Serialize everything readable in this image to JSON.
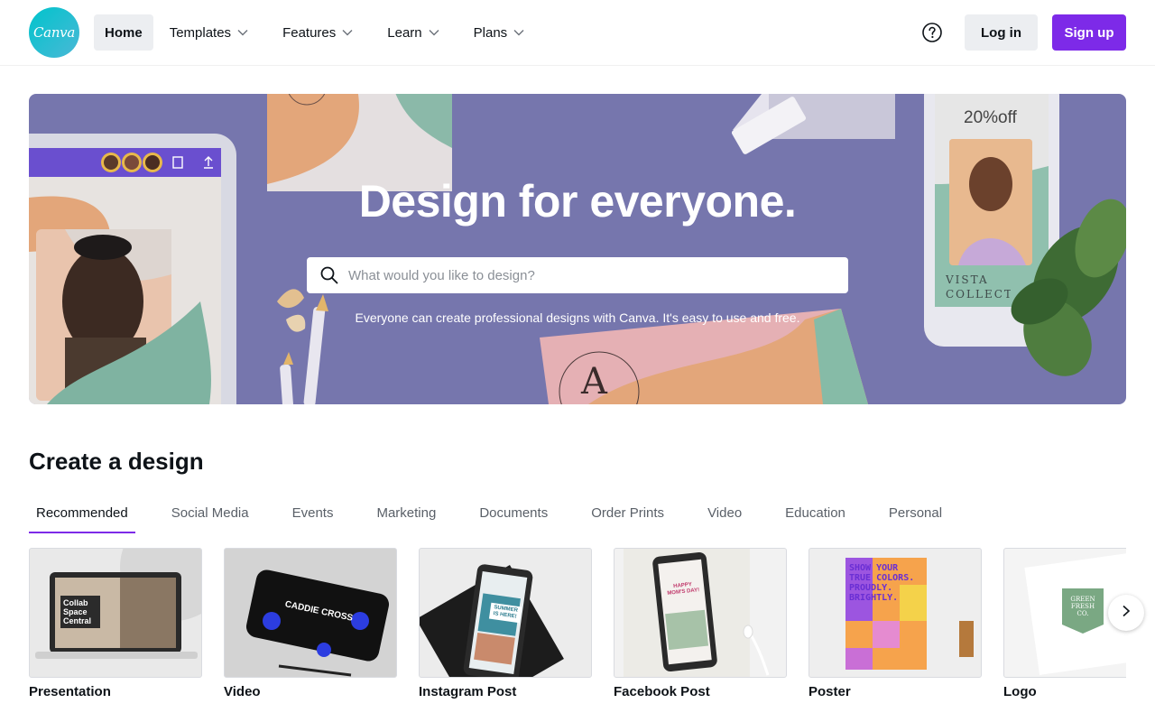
{
  "brand": {
    "logo_text": "Canva",
    "accent": "#7d2ae8",
    "logo_color": "#00c4cc"
  },
  "nav": {
    "items": [
      {
        "label": "Home",
        "active": true,
        "dropdown": false
      },
      {
        "label": "Templates",
        "active": false,
        "dropdown": true
      },
      {
        "label": "Features",
        "active": false,
        "dropdown": true
      },
      {
        "label": "Learn",
        "active": false,
        "dropdown": true
      },
      {
        "label": "Plans",
        "active": false,
        "dropdown": true
      }
    ],
    "help_icon": "question-circle-icon",
    "login_label": "Log in",
    "signup_label": "Sign up"
  },
  "hero": {
    "title": "Design for everyone.",
    "search_placeholder": "What would you like to design?",
    "subtitle": "Everyone can create professional designs with Canva. It's easy to use and free.",
    "promo_text": "20%off",
    "promo_brand": "VISTA COLLECTI",
    "card_letter": "A",
    "background_color": "#7676ad"
  },
  "create": {
    "title": "Create a design",
    "tabs": [
      {
        "label": "Recommended",
        "active": true
      },
      {
        "label": "Social Media",
        "active": false
      },
      {
        "label": "Events",
        "active": false
      },
      {
        "label": "Marketing",
        "active": false
      },
      {
        "label": "Documents",
        "active": false
      },
      {
        "label": "Order Prints",
        "active": false
      },
      {
        "label": "Video",
        "active": false
      },
      {
        "label": "Education",
        "active": false
      },
      {
        "label": "Personal",
        "active": false
      }
    ],
    "cards": [
      {
        "label": "Presentation",
        "thumb_text": "Collab Space Central"
      },
      {
        "label": "Video",
        "thumb_text": "CADDIE CROSS"
      },
      {
        "label": "Instagram Post",
        "thumb_text": "SUMMER IS HERE!"
      },
      {
        "label": "Facebook Post",
        "thumb_text": "HAPPY MOM'S DAY!"
      },
      {
        "label": "Poster",
        "thumb_text": "SHOW YOUR TRUE COLORS. PROUDLY. BRIGHTLY."
      },
      {
        "label": "Logo",
        "thumb_text": "GREEN FRESH CO."
      }
    ],
    "next_icon": "chevron-right-icon"
  }
}
